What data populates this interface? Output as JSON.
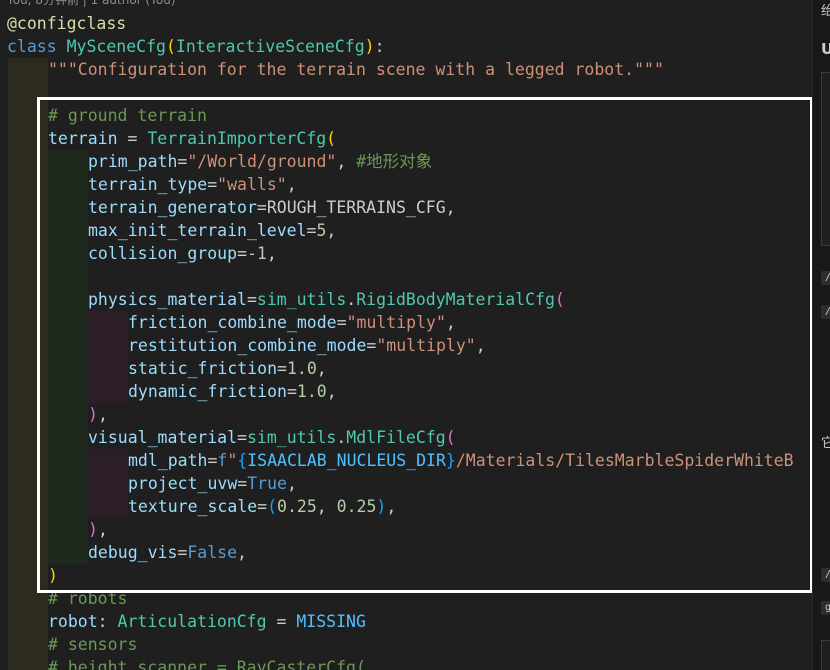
{
  "blame": "You, 8分钟前 | 1 author (You)",
  "code": {
    "decorator": "@configclass",
    "class_kw": "class",
    "class_name": "MySceneCfg",
    "base_class": "InteractiveSceneCfg",
    "docstring": "\"\"\"Configuration for the terrain scene with a legged robot.\"\"\"",
    "cmt_ground": "# ground terrain",
    "terrain_var": "terrain",
    "terrain_cls": "TerrainImporterCfg",
    "prim_path_key": "prim_path",
    "prim_path_val": "\"/World/ground\"",
    "prim_path_cmt": "#地形对象",
    "terrain_type_key": "terrain_type",
    "terrain_type_val": "\"walls\"",
    "terrain_gen_key": "terrain_generator",
    "terrain_gen_val": "ROUGH_TERRAINS_CFG",
    "max_level_key": "max_init_terrain_level",
    "max_level_val": "5",
    "collision_key": "collision_group",
    "collision_val": "-1",
    "phys_key": "physics_material",
    "sim_utils": "sim_utils",
    "rigid_cls": "RigidBodyMaterialCfg",
    "fric_mode_key": "friction_combine_mode",
    "fric_mode_val": "\"multiply\"",
    "rest_mode_key": "restitution_combine_mode",
    "rest_mode_val": "\"multiply\"",
    "static_key": "static_friction",
    "static_val": "1.0",
    "dynamic_key": "dynamic_friction",
    "dynamic_val": "1.0",
    "visual_key": "visual_material",
    "mdl_cls": "MdlFileCfg",
    "mdl_key": "mdl_path",
    "mdl_f": "f",
    "mdl_q": "\"",
    "mdl_var": "ISAACLAB_NUCLEUS_DIR",
    "mdl_rest": "/Materials/TilesMarbleSpiderWhiteB",
    "uvw_key": "project_uvw",
    "uvw_val": "True",
    "tex_key": "texture_scale",
    "tex_a": "0.25",
    "tex_b": "0.25",
    "debug_key": "debug_vis",
    "debug_val": "False",
    "cmt_robots": "# robots",
    "robot_var": "robot",
    "robot_cls": "ArticulationCfg",
    "robot_val": "MISSING",
    "cmt_sensors": "# sensors",
    "cmt_height": "# height_scanner = RayCasterCfg("
  },
  "side": {
    "t1": "绐",
    "t2": "U",
    "chip1": "/",
    "chip2": "/",
    "t3": "它",
    "chip3": "/",
    "chip4": "g"
  },
  "colors": {
    "keyword": "#569cd6",
    "class": "#4ec9b0",
    "string": "#ce9178",
    "comment": "#6a9955",
    "number": "#b5cea8",
    "highlight_box": "#ffffff"
  }
}
